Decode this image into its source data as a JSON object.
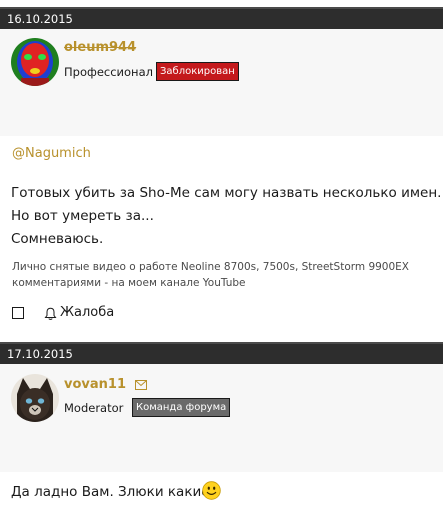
{
  "posts": [
    {
      "date": "16.10.2015",
      "author": {
        "username": "oleum944",
        "title": "Профессионал",
        "badge": "Заблокирован"
      },
      "mention": "@Nagumich",
      "lines": [
        "Готовых убить за Sho-Me сам могу назвать несколько имен.",
        "Но вот умереть за...",
        "Сомневаюсь."
      ],
      "signature": [
        "Лично снятые видео о работе Neoline 8700s, 7500s, StreetStorm 9900EX",
        "комментариями - на моем канале YouTube"
      ],
      "report_label": "Жалоба"
    },
    {
      "date": "17.10.2015",
      "author": {
        "username": "vovan11",
        "title": "Moderator",
        "badge": "Команда форума"
      },
      "lines": [
        "Да ладно Вам. Злюки какие"
      ]
    }
  ],
  "icons": {
    "envelope": "envelope-icon",
    "bell": "bell-icon",
    "checkbox": "checkbox-icon",
    "smiley": "smiley-icon"
  },
  "colors": {
    "accent": "#b8912c",
    "date_bar": "#2d2d2d",
    "banned_badge": "#c4191c",
    "staff_badge": "#6a6a6a"
  }
}
